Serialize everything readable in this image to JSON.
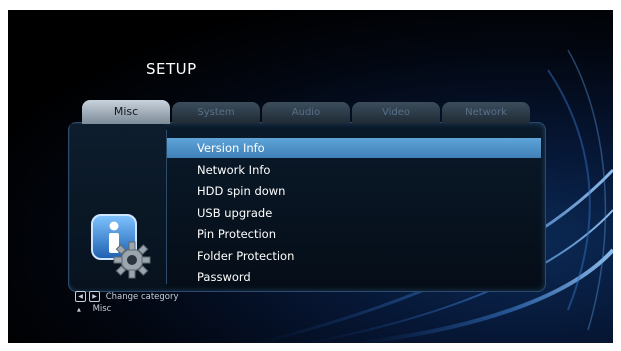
{
  "header": {
    "title": "SETUP"
  },
  "tabs": [
    {
      "label": "Misc",
      "active": true
    },
    {
      "label": "System",
      "active": false
    },
    {
      "label": "Audio",
      "active": false
    },
    {
      "label": "Video",
      "active": false
    },
    {
      "label": "Network",
      "active": false
    }
  ],
  "menu": {
    "items": [
      {
        "label": "Version Info",
        "selected": true
      },
      {
        "label": "Network Info",
        "selected": false
      },
      {
        "label": "HDD spin down",
        "selected": false
      },
      {
        "label": "USB upgrade",
        "selected": false
      },
      {
        "label": "Pin Protection",
        "selected": false
      },
      {
        "label": "Folder Protection",
        "selected": false
      },
      {
        "label": "Password",
        "selected": false
      }
    ]
  },
  "footer": {
    "change_category_label": "Change category",
    "current_category": "Misc",
    "left_key_glyph": "◀",
    "right_key_glyph": "▶",
    "up_key_glyph": "▲"
  },
  "colors": {
    "selected_bg": "#4f93cc",
    "panel_border": "#2c4b6a",
    "active_tab": "#c8d2dc"
  },
  "icons": {
    "category_icon": "info-icon",
    "category_badge": "gear-icon"
  }
}
